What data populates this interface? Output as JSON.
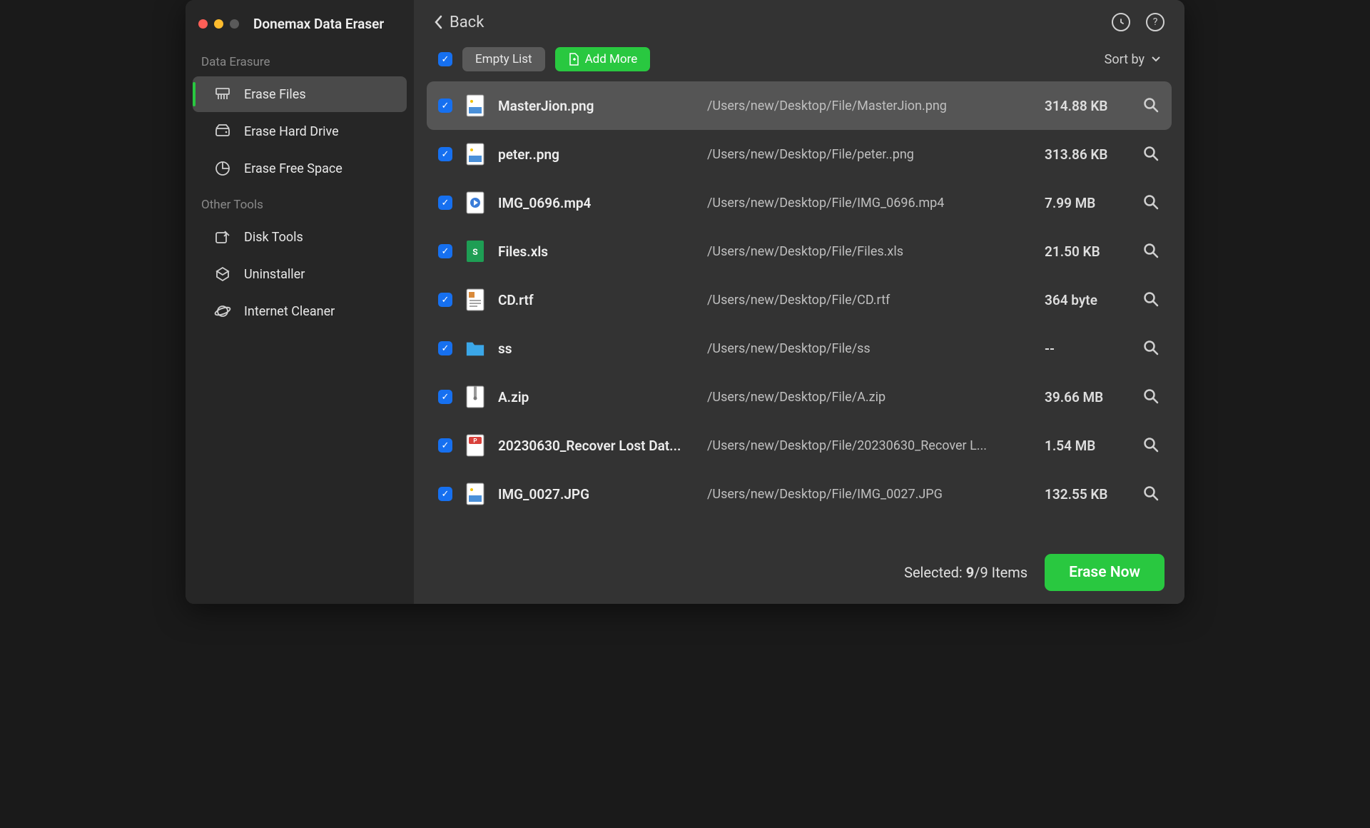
{
  "app_title": "Donemax Data Eraser",
  "sidebar": {
    "section1": "Data Erasure",
    "items1": [
      {
        "label": "Erase Files",
        "icon": "shredder-icon",
        "active": true
      },
      {
        "label": "Erase Hard Drive",
        "icon": "drive-icon",
        "active": false
      },
      {
        "label": "Erase Free Space",
        "icon": "pie-icon",
        "active": false
      }
    ],
    "section2": "Other Tools",
    "items2": [
      {
        "label": "Disk Tools",
        "icon": "disk-tools-icon"
      },
      {
        "label": "Uninstaller",
        "icon": "uninstall-icon"
      },
      {
        "label": "Internet Cleaner",
        "icon": "planet-icon"
      }
    ]
  },
  "header": {
    "back": "Back",
    "empty_list": "Empty List",
    "add_more": "Add More",
    "sort_by": "Sort by"
  },
  "files": [
    {
      "checked": true,
      "selected": true,
      "icon": "image",
      "name": "MasterJion.png",
      "path": "/Users/new/Desktop/File/MasterJion.png",
      "size": "314.88 KB"
    },
    {
      "checked": true,
      "selected": false,
      "icon": "image",
      "name": "peter..png",
      "path": "/Users/new/Desktop/File/peter..png",
      "size": "313.86 KB"
    },
    {
      "checked": true,
      "selected": false,
      "icon": "video",
      "name": "IMG_0696.mp4",
      "path": "/Users/new/Desktop/File/IMG_0696.mp4",
      "size": "7.99 MB"
    },
    {
      "checked": true,
      "selected": false,
      "icon": "xls",
      "name": "Files.xls",
      "path": "/Users/new/Desktop/File/Files.xls",
      "size": "21.50 KB"
    },
    {
      "checked": true,
      "selected": false,
      "icon": "rtf",
      "name": "CD.rtf",
      "path": "/Users/new/Desktop/File/CD.rtf",
      "size": "364 byte"
    },
    {
      "checked": true,
      "selected": false,
      "icon": "folder",
      "name": "ss",
      "path": "/Users/new/Desktop/File/ss",
      "size": "--"
    },
    {
      "checked": true,
      "selected": false,
      "icon": "zip",
      "name": "A.zip",
      "path": "/Users/new/Desktop/File/A.zip",
      "size": "39.66 MB"
    },
    {
      "checked": true,
      "selected": false,
      "icon": "pdf",
      "name": "20230630_Recover Lost Dat...",
      "path": "/Users/new/Desktop/File/20230630_Recover L...",
      "size": "1.54 MB"
    },
    {
      "checked": true,
      "selected": false,
      "icon": "image",
      "name": "IMG_0027.JPG",
      "path": "/Users/new/Desktop/File/IMG_0027.JPG",
      "size": "132.55 KB"
    }
  ],
  "footer": {
    "selected_label": "Selected: ",
    "selected_count": "9",
    "total_suffix": "/9 Items",
    "erase_now": "Erase Now"
  }
}
